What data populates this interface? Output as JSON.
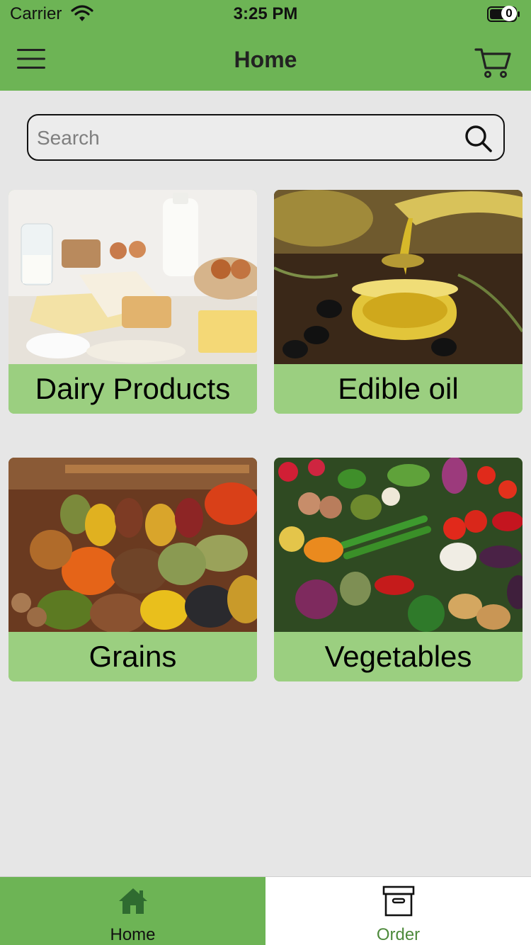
{
  "status_bar": {
    "carrier": "Carrier",
    "time": "3:25 PM"
  },
  "header": {
    "title": "Home",
    "menu_icon": "hamburger-icon",
    "cart_icon": "cart-icon",
    "cart_count": "0"
  },
  "search": {
    "placeholder": "Search",
    "value": "",
    "icon": "search-icon"
  },
  "categories": [
    {
      "label": "Dairy Products",
      "image": "dairy-products-photo"
    },
    {
      "label": "Edible oil",
      "image": "edible-oil-photo"
    },
    {
      "label": "Grains",
      "image": "grains-spices-photo"
    },
    {
      "label": "Vegetables",
      "image": "vegetables-photo"
    }
  ],
  "tabbar": {
    "tabs": [
      {
        "label": "Home",
        "icon": "home-icon",
        "active": true
      },
      {
        "label": "Order",
        "icon": "archive-box-icon",
        "active": false
      }
    ]
  },
  "colors": {
    "brand_green": "#6db455",
    "card_label_green": "#9bcf80",
    "background": "#e6e6e6",
    "inactive_tab_text": "#4e8a3c"
  }
}
